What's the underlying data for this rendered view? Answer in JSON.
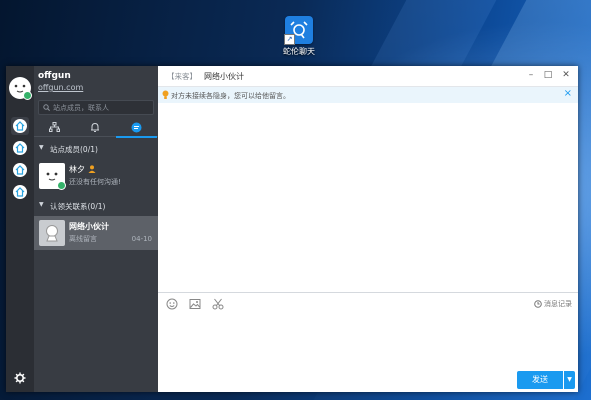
{
  "desktop": {
    "icon_label": "蛇伦聊天",
    "icon_name": "chat-app-icon"
  },
  "user": {
    "name": "offgun",
    "domain": "offgun.com",
    "status_color": "#35b26a"
  },
  "search": {
    "placeholder": "站点成员，联系人"
  },
  "groups": [
    {
      "label": "站点成员(0/1)"
    },
    {
      "label": "认领关联系(0/1)"
    }
  ],
  "contacts": [
    {
      "name": "林夕",
      "status": "还没有任何沟通!",
      "time": ""
    },
    {
      "name": "网络小伙计",
      "status": "离线留言",
      "time": "04-10"
    }
  ],
  "chat": {
    "tag": "【来客】",
    "title": "网络小伙计",
    "notice": "对方未接续各隐身，您可以给他留言。",
    "history": "消息记录",
    "send": "发送",
    "accent": "#1a9af0"
  },
  "window_controls": {
    "minimize": "–",
    "maximize": "□",
    "close": "✕"
  }
}
